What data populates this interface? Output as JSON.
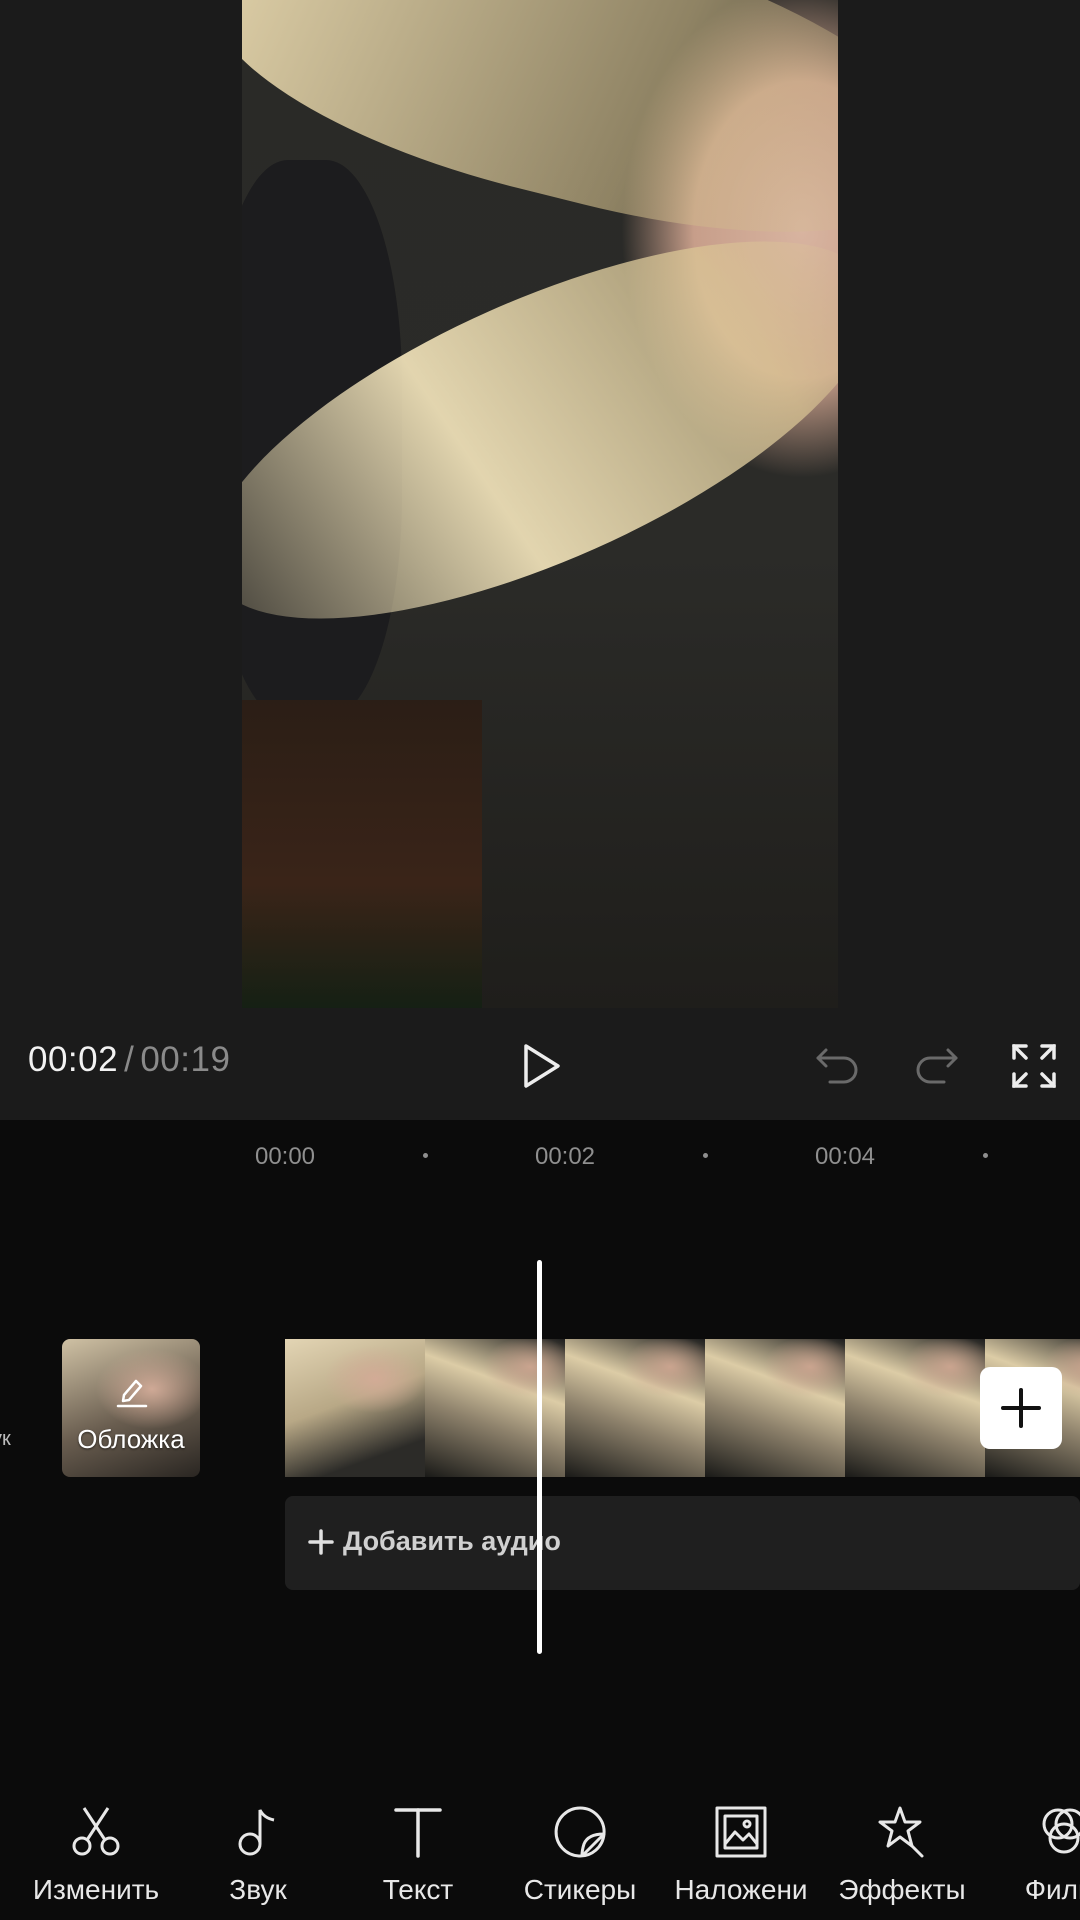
{
  "player": {
    "current_time": "00:02",
    "separator": "/",
    "total_time": "00:19"
  },
  "timeline": {
    "ruler": [
      "00:00",
      "00:02",
      "00:04"
    ],
    "side_label": "ук",
    "cover_label": "Обложка",
    "add_audio_label": "Добавить аудио"
  },
  "toolbar": {
    "items": [
      {
        "label": "Изменить",
        "icon": "scissors-icon"
      },
      {
        "label": "Звук",
        "icon": "music-note-icon"
      },
      {
        "label": "Текст",
        "icon": "text-icon"
      },
      {
        "label": "Стикеры",
        "icon": "sticker-icon"
      },
      {
        "label": "Наложени",
        "icon": "overlay-icon"
      },
      {
        "label": "Эффекты",
        "icon": "effects-star-icon"
      },
      {
        "label": "Фильт",
        "icon": "filters-icon"
      }
    ]
  },
  "colors": {
    "background": "#0b0b0b",
    "panel": "#1b1b1b",
    "text": "#e8e8e8",
    "muted_text": "#8a8a8a",
    "playhead": "#ffffff"
  }
}
